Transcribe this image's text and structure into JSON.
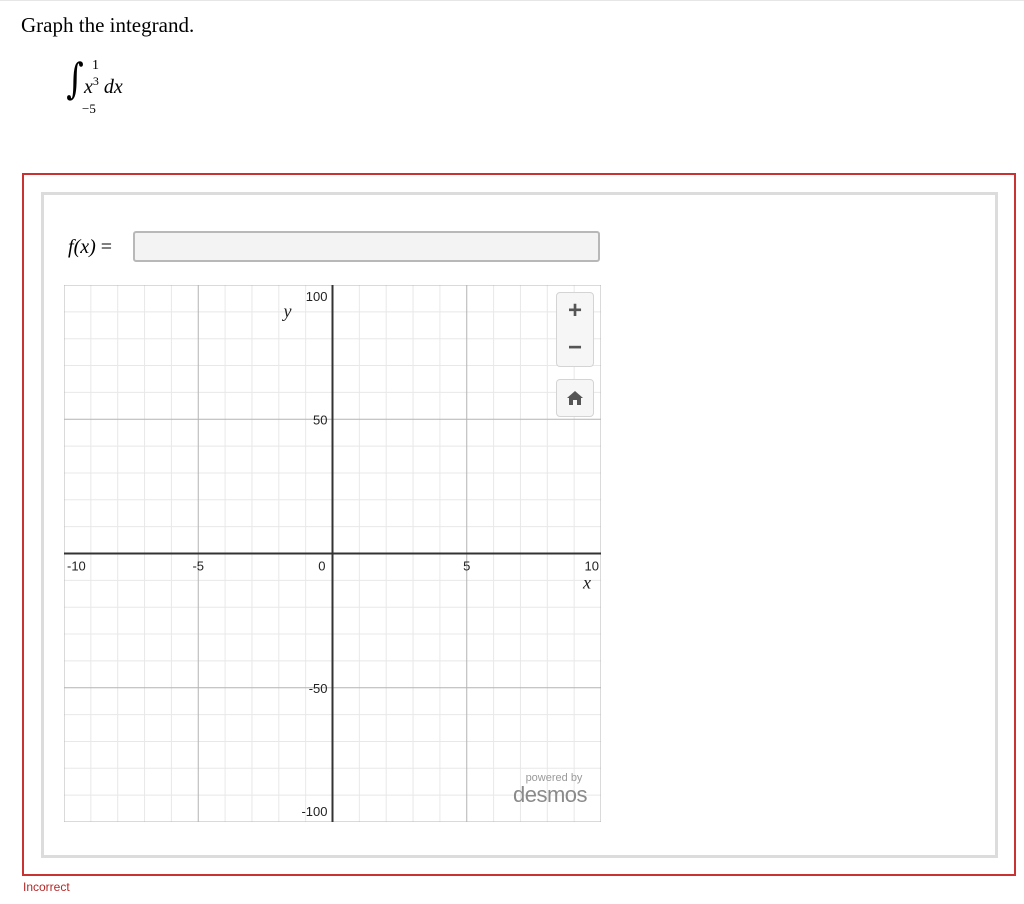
{
  "question": {
    "prompt": "Graph the integrand."
  },
  "integral": {
    "sign": "∫",
    "upper": "1",
    "lower": "−5",
    "variable": "x",
    "exponent": "3",
    "differential": "dx"
  },
  "answer": {
    "function_label_name": "f",
    "function_label_arg": "(x)",
    "function_label_eq": "=",
    "input_value": "",
    "input_placeholder": ""
  },
  "graph": {
    "x_axis_label": "x",
    "y_axis_label": "y",
    "x_ticks": [
      "-10",
      "-5",
      "0",
      "5",
      "10"
    ],
    "y_ticks": [
      "100",
      "50",
      "-50",
      "-100"
    ],
    "xlim": [
      -10,
      10
    ],
    "ylim": [
      -100,
      100
    ],
    "minor_x_step": 1,
    "minor_y_step": 10,
    "major_x_step": 5,
    "major_y_step": 50,
    "grid": true,
    "zoom_in_label": "+",
    "zoom_out_label": "−",
    "home_icon": "home-icon",
    "powered_by": "powered by",
    "brand": "desmos"
  },
  "status": {
    "text": "Incorrect",
    "color": "#b42828"
  },
  "colors": {
    "frame_border": "#c83232",
    "panel_border": "#dcdcdc",
    "grid_minor": "#e8e8e8",
    "grid_major": "#b4b4b4",
    "axis": "#333333"
  }
}
